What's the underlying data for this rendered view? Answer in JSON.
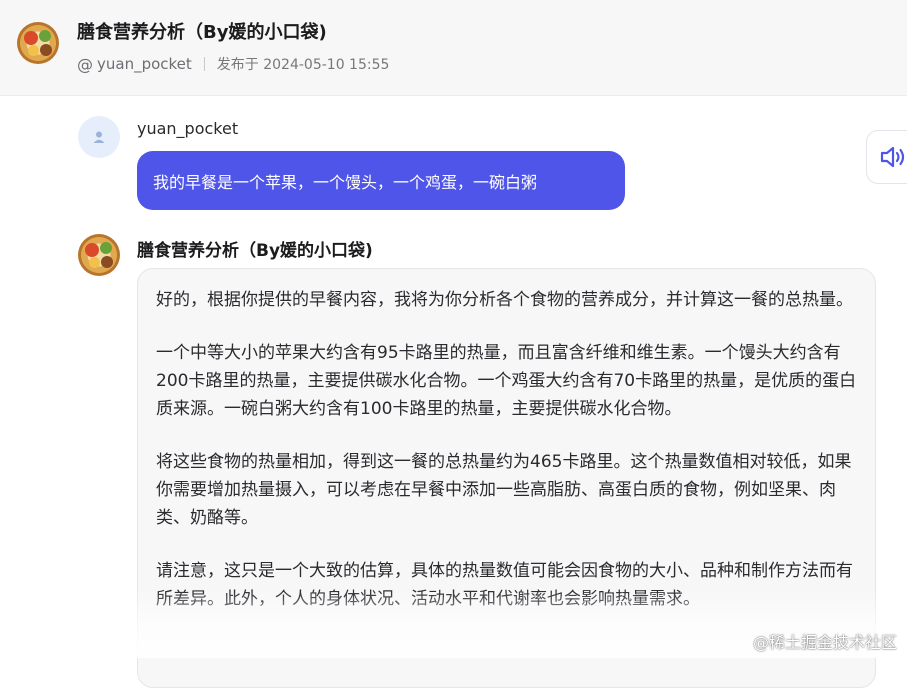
{
  "header": {
    "title": "膳食营养分析（By媛的小口袋)",
    "author": "yuan_pocket",
    "published": "发布于 2024-05-10 15:55"
  },
  "user_message": {
    "username": "yuan_pocket",
    "text": "我的早餐是一个苹果，一个馒头，一个鸡蛋，一碗白粥"
  },
  "bot_message": {
    "name": "膳食营养分析（By媛的小口袋)",
    "paragraphs": [
      "好的，根据你提供的早餐内容，我将为你分析各个食物的营养成分，并计算这一餐的总热量。",
      "一个中等大小的苹果大约含有95卡路里的热量，而且富含纤维和维生素。一个馒头大约含有200卡路里的热量，主要提供碳水化合物。一个鸡蛋大约含有70卡路里的热量，是优质的蛋白质来源。一碗白粥大约含有100卡路里的热量，主要提供碳水化合物。",
      "将这些食物的热量相加，得到这一餐的总热量约为465卡路里。这个热量数值相对较低，如果你需要增加热量摄入，可以考虑在早餐中添加一些高脂肪、高蛋白质的食物，例如坚果、肉类、奶酪等。",
      "请注意，这只是一个大致的估算，具体的热量数值可能会因食物的大小、品种和制作方法而有所差异。此外，个人的身体状况、活动水平和代谢率也会影响热量需求。"
    ]
  },
  "watermark": "@稀土掘金技术社区",
  "icons": {
    "bot_avatar": "food-plate-icon",
    "user_avatar": "user-icon",
    "author_prefix": "at-icon",
    "speaker": "speaker-icon"
  },
  "colors": {
    "user_bubble": "#4f55e8",
    "bot_bubble": "#f7f7f8",
    "header_bg": "#f7f7f8",
    "speaker_icon": "#4f55e8"
  }
}
